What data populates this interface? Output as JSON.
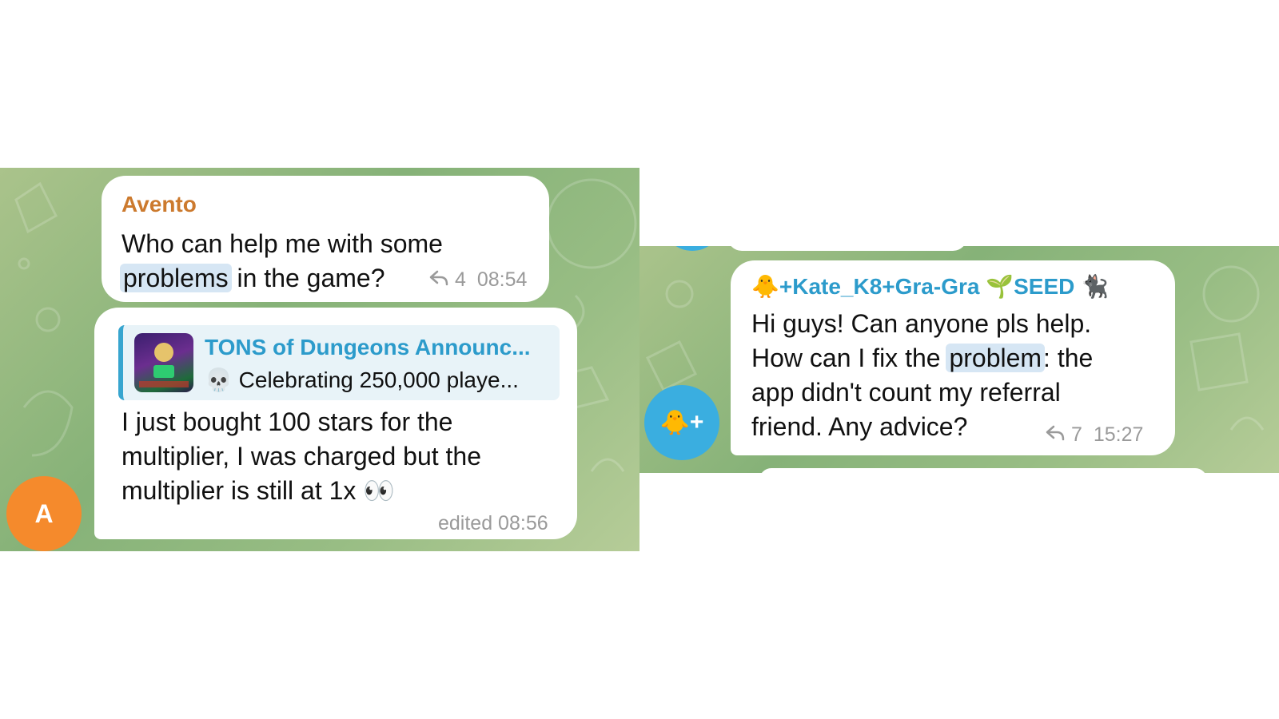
{
  "left": {
    "avatar_letter": "A",
    "msg1": {
      "sender": "Avento",
      "text_line1": "Who can help me with some",
      "highlight": "problems",
      "text_line2_rest": " in the game?",
      "reply_icon": "reply-icon",
      "reply_count": "4",
      "time": "08:54"
    },
    "msg2": {
      "quote_title": "TONS of Dungeons Announc...",
      "quote_emoji": "💀",
      "quote_text": "Celebrating 250,000 playe...",
      "text_line1": "I just bought 100 stars for the",
      "text_line2": "multiplier, I was charged but the",
      "text_line3": "multiplier is still at 1x",
      "eyes_emoji": "👀",
      "edited": "edited 08:56"
    }
  },
  "right": {
    "avatar_chick": "🐥",
    "avatar_plus": "+",
    "msg": {
      "sender_chick": "🐥",
      "sender_name": "+Kate_K8+Gra-Gra",
      "sender_sprout": "🌱",
      "sender_tag": "SEED",
      "sender_cat": "🐈‍⬛",
      "text_line1": "Hi guys! Can anyone pls help.",
      "text_line2_start": "How can I fix the ",
      "highlight": "problem",
      "text_line2_rest": ": the",
      "text_line3": "app didn't count my referral",
      "text_line4": "friend. Any advice?",
      "reply_icon": "reply-icon",
      "reply_count": "7",
      "time": "15:27"
    }
  },
  "colors": {
    "sender_avento": "#cc7a2e",
    "sender_kate": "#2c9bcb",
    "avatar_orange": "#f58a2c",
    "avatar_blue": "#3aaee0"
  }
}
